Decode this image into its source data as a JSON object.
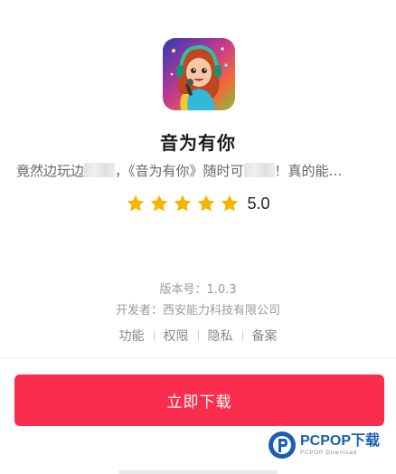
{
  "app": {
    "name": "音为有你",
    "desc_parts": [
      "竟然边玩边",
      "，《音为有你》随时可",
      "！真的能…"
    ],
    "icon": "girl-singer-app-icon"
  },
  "rating": {
    "stars": 5,
    "max_stars": 5,
    "value": "5.0",
    "star_color": "#f7b500"
  },
  "meta": {
    "version": "版本号：1.0.3",
    "developer": "开发者：西安能力科技有限公司"
  },
  "links": [
    "功能",
    "权限",
    "隐私",
    "备案"
  ],
  "download": {
    "label": "立即下载",
    "color": "#fb2d4e"
  },
  "watermark": {
    "main": "PCPOP下载",
    "sub": "PCPOP Download"
  }
}
